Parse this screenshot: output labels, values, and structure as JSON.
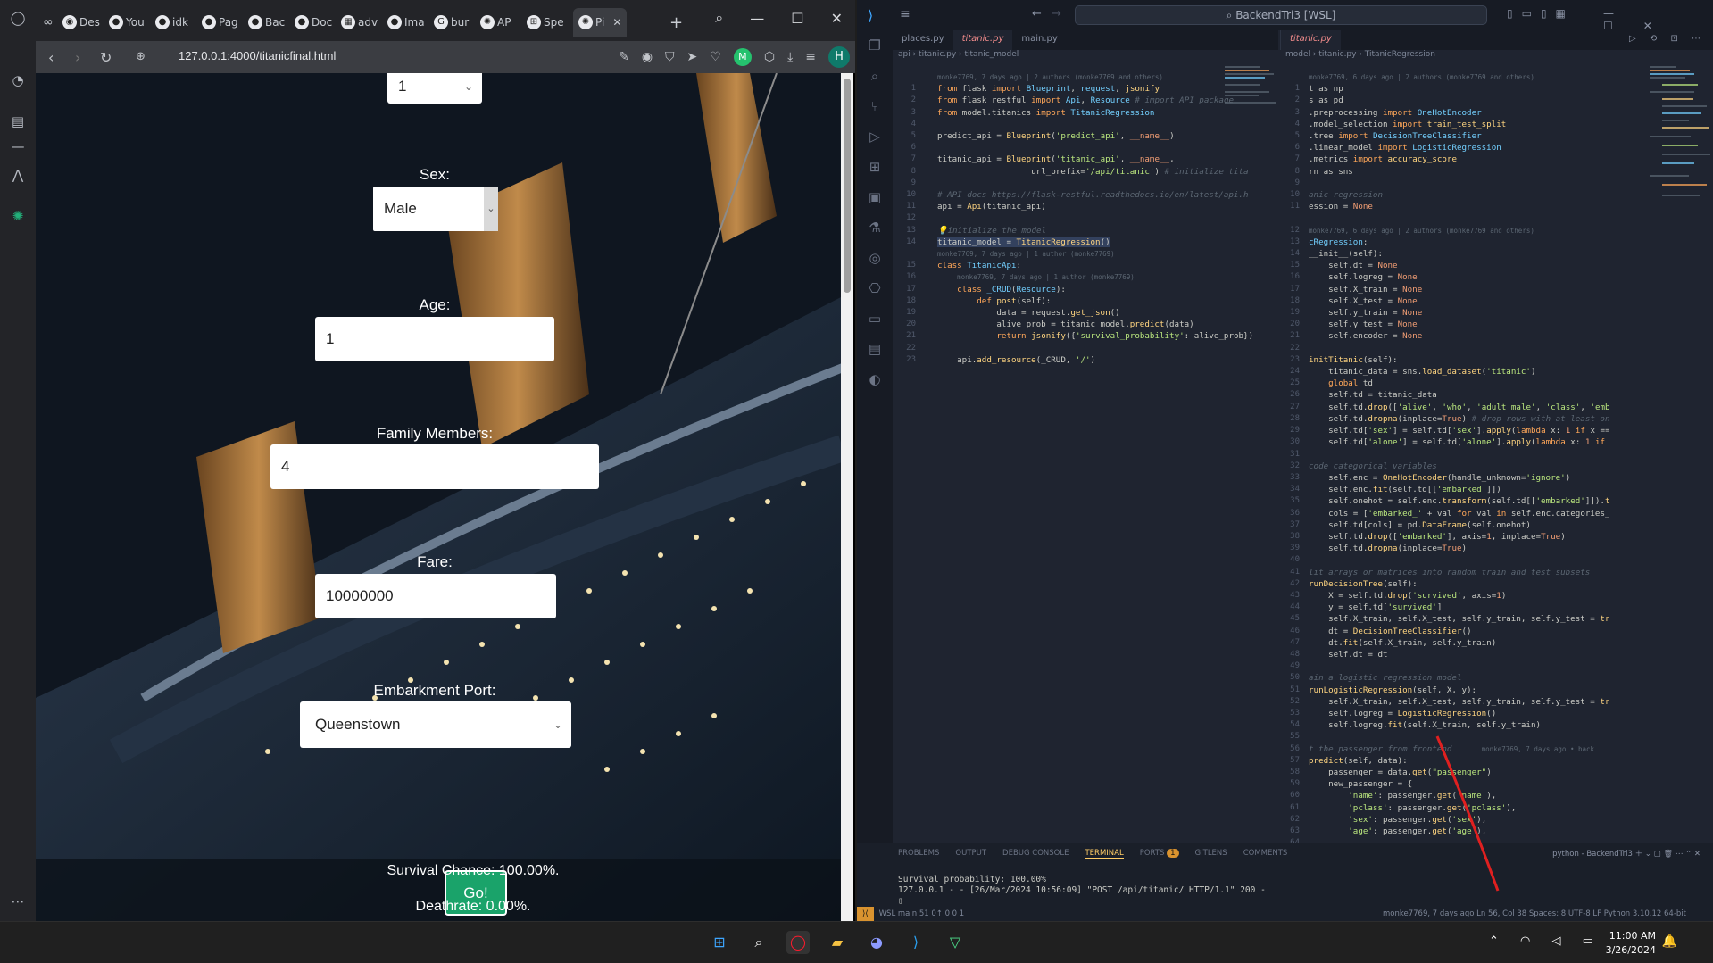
{
  "browser": {
    "tabs": [
      {
        "icon": "discord-icon",
        "label": "Des"
      },
      {
        "icon": "github-icon",
        "label": "You"
      },
      {
        "icon": "github-icon",
        "label": "idk"
      },
      {
        "icon": "github-icon",
        "label": "Pag"
      },
      {
        "icon": "github-icon",
        "label": "Bac"
      },
      {
        "icon": "github-icon",
        "label": "Doc"
      },
      {
        "icon": "hashnode-icon",
        "label": "adv"
      },
      {
        "icon": "github-icon",
        "label": "Ima"
      },
      {
        "icon": "google-icon",
        "label": "bur"
      },
      {
        "icon": "openai-icon",
        "label": "AP"
      },
      {
        "icon": "grid-icon",
        "label": "Spe"
      },
      {
        "icon": "openai-icon",
        "label": "Pi"
      }
    ],
    "url": "127.0.0.1:4000/titanicfinal.html",
    "profile_initial": "H"
  },
  "form": {
    "pclass_value": "1",
    "sex_label": "Sex:",
    "sex_value": "Male",
    "age_label": "Age:",
    "age_value": "1",
    "family_label": "Family Members:",
    "family_value": "4",
    "fare_label": "Fare:",
    "fare_value": "10000000",
    "port_label": "Embarkment Port:",
    "port_value": "Queenstown",
    "go_label": "Go!",
    "survival_text": "Survival Chance: 100.00%.",
    "death_text": "Deathrate: 0.00%."
  },
  "vscode": {
    "command_center": "BackendTri3 [WSL]",
    "left_tabs": [
      "places.py",
      "titanic.py",
      "main.py"
    ],
    "right_tabs": [
      "titanic.py"
    ],
    "left_breadcrumb": "api › titanic.py › titanic_model",
    "right_breadcrumb": "model › titanic.py › TitanicRegression",
    "panel_tabs": [
      "PROBLEMS",
      "OUTPUT",
      "DEBUG CONSOLE",
      "TERMINAL",
      "PORTS",
      "GITLENS",
      "COMMENTS"
    ],
    "ports_count": "1",
    "terminal_name": "python - BackendTri3",
    "terminal_lines": [
      "Survival probability: 100.00%",
      "127.0.0.1 - - [26/Mar/2024 10:56:09] \"POST /api/titanic/ HTTP/1.1\" 200 -",
      ""
    ],
    "status_left": "WSL   main   51 0↑   0  0   1",
    "status_right": "monke7769, 7 days ago   Ln 56, Col 38   Spaces: 8   UTF-8   LF   Python   3.10.12 64-bit"
  },
  "taskbar": {
    "time": "11:00 AM",
    "date": "3/26/2024"
  }
}
